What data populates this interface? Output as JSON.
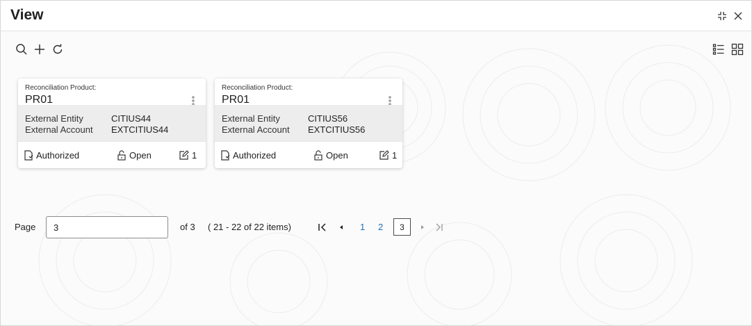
{
  "header": {
    "title": "View"
  },
  "cards": [
    {
      "product_label": "Reconciliation Product:",
      "product_value": "PR01",
      "entity_key": "External Entity",
      "entity_value": "CITIUS44",
      "account_key": "External Account",
      "account_value": "EXTCITIUS44",
      "status": "Authorized",
      "lock_status": "Open",
      "edit_count": "1"
    },
    {
      "product_label": "Reconciliation Product:",
      "product_value": "PR01",
      "entity_key": "External Entity",
      "entity_value": "CITIUS56",
      "account_key": "External Account",
      "account_value": "EXTCITIUS56",
      "status": "Authorized",
      "lock_status": "Open",
      "edit_count": "1"
    }
  ],
  "pagination": {
    "page_label": "Page",
    "page_value": "3",
    "of_text": "of 3",
    "items_text": "( 21 - 22 of 22 items)",
    "pages": [
      "1",
      "2"
    ],
    "current_page": "3"
  },
  "colors": {
    "link": "#1e6fb8",
    "card_body": "#ededed",
    "text": "#1f1f1f"
  },
  "icons": [
    "minimize-icon",
    "close-icon",
    "search-icon",
    "add-icon",
    "refresh-icon",
    "list-view-icon",
    "grid-view-icon",
    "kebab-menu-icon",
    "authorized-icon",
    "unlock-icon",
    "edit-icon",
    "first-page-icon",
    "previous-page-icon",
    "next-page-icon",
    "last-page-icon"
  ]
}
